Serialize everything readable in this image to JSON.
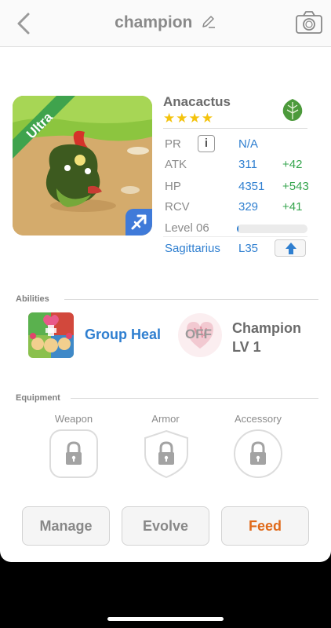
{
  "header": {
    "title": "champion",
    "back_icon": "chevron-left-icon",
    "edit_icon": "pencil-icon",
    "camera_icon": "camera-icon"
  },
  "monster": {
    "name": "Anacactus",
    "rarity": "Ultra",
    "star_count": 4,
    "stars": "★★★★",
    "element_icon": "leaf-icon",
    "sign_icon": "arrow-icon"
  },
  "stats": {
    "pr": {
      "label": "PR",
      "info": "i",
      "value": "N/A"
    },
    "atk": {
      "label": "ATK",
      "value": "311",
      "bonus": "+42"
    },
    "hp": {
      "label": "HP",
      "value": "4351",
      "bonus": "+543"
    },
    "rcv": {
      "label": "RCV",
      "value": "329",
      "bonus": "+41"
    },
    "level": {
      "label": "Level 06",
      "progress": 0.02
    },
    "constellation": {
      "label": "Sagittarius",
      "level": "L35",
      "upgrade_icon": "arrow-up-icon"
    }
  },
  "abilities": {
    "title": "Abilities",
    "skill": {
      "name": "Group Heal"
    },
    "leader": {
      "status": "OFF",
      "name_line1": "Champion",
      "name_line2": "LV 1"
    }
  },
  "equipment": {
    "title": "Equipment",
    "slots": [
      {
        "label": "Weapon"
      },
      {
        "label": "Armor"
      },
      {
        "label": "Accessory"
      }
    ]
  },
  "actions": {
    "manage": "Manage",
    "evolve": "Evolve",
    "feed": "Feed"
  },
  "colors": {
    "accent_blue": "#2f7fd0",
    "bonus_green": "#36a54e",
    "feed_orange": "#e06a1a",
    "star": "#f4c30d",
    "leaf": "#4c9a3b"
  }
}
